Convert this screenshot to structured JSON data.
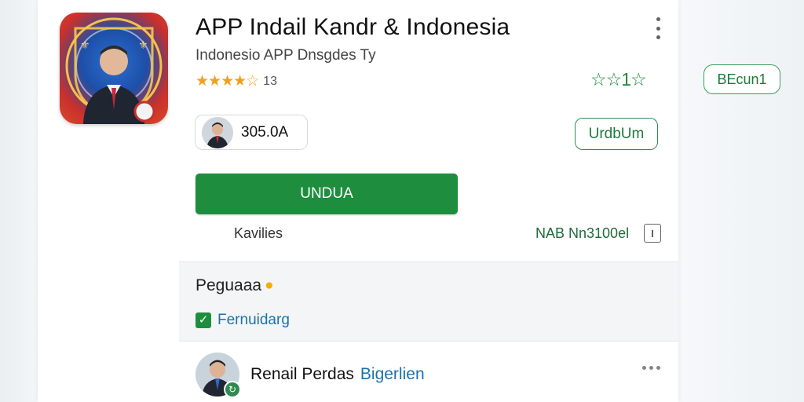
{
  "app": {
    "title": "APP Indail Kandr & Indonesia",
    "developer": "Indonesio APP Dnsgdes Ty",
    "rating_stars": "★★★★☆",
    "rating_count": "13",
    "size": "305.0A",
    "install_label": "UNDUA",
    "update_label": "UrdbUm",
    "outline_rating": "☆☆1☆",
    "side_pill": "BEcun1"
  },
  "meta": {
    "left_label": "Kavilies",
    "right_label": "NAB Nn3100el"
  },
  "permissions": {
    "title": "Peguaaa",
    "title_icon": "●",
    "checkbox_mark": "✓",
    "checkbox_label": "Fernuidarg"
  },
  "review": {
    "reviewer_name": "Renail Perdas",
    "reviewer_tag": "Bigerlien",
    "badge": "↻"
  },
  "colors": {
    "accent_green": "#1e8e3e",
    "star_orange": "#f0a020",
    "link_blue": "#1a73a8"
  }
}
